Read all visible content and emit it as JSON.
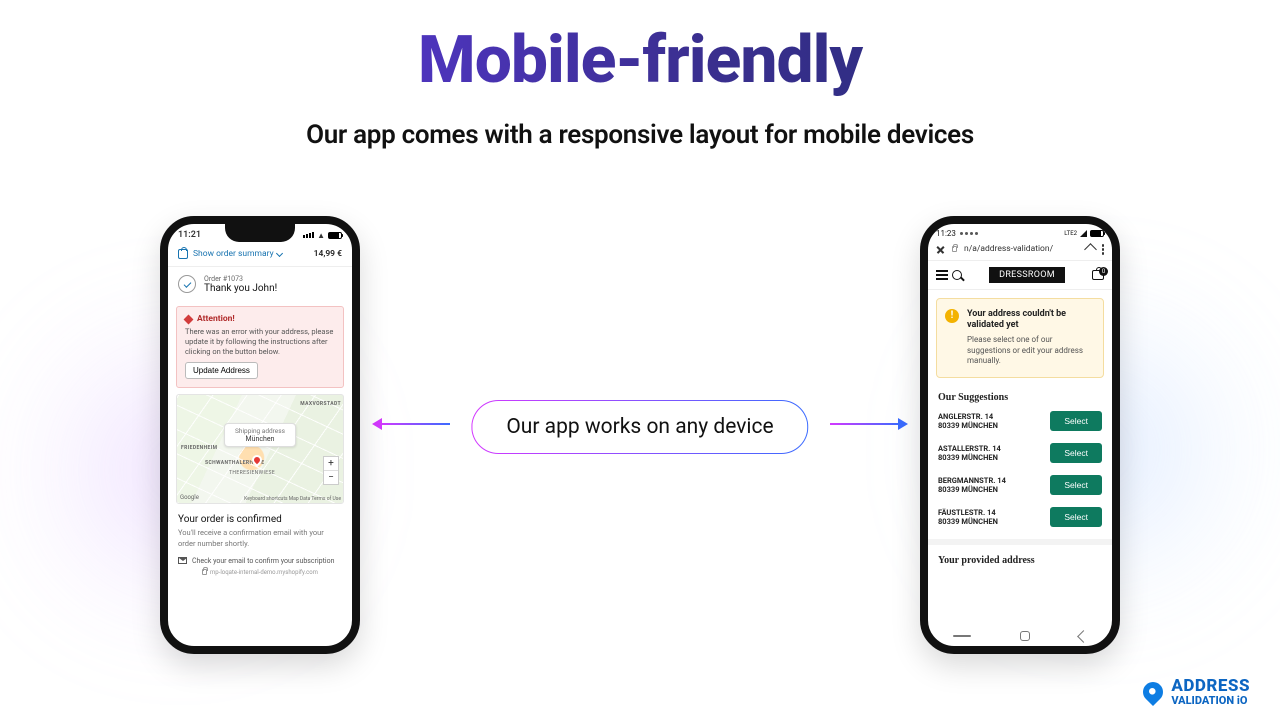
{
  "hero": {
    "title": "Mobile-friendly",
    "subtitle": "Our app comes with a responsive layout for mobile devices",
    "pill": "Our app works on any device"
  },
  "footer_logo": {
    "line1": "ADDRESS",
    "line2": "VALIDATION iO"
  },
  "left_phone": {
    "status_time": "11:21",
    "summary_label": "Show order summary",
    "summary_price": "14,99 €",
    "order_label": "Order #1073",
    "thank_you": "Thank you John!",
    "alert_title": "Attention!",
    "alert_body": "There was an error with your address, please update it by following the instructions after clicking on the button below.",
    "alert_button": "Update Address",
    "map_chip_title": "Shipping address",
    "map_chip_city": "München",
    "map_attrib": "Keyboard shortcuts   Map Data   Terms of Use",
    "map_google": "Google",
    "map_labels": {
      "nw": "FRIEDENHEIM",
      "ne": "MAXVORSTADT",
      "mid": "SCHWANTHALERHÖHE",
      "sub": "THERESIENWIESE"
    },
    "confirmed_h": "Your order is confirmed",
    "confirmed_p": "You'll receive a confirmation email with your order number shortly.",
    "sub_text": "Check your email to confirm your subscription",
    "site_url": "mp-loqate-internal-demo.myshopify.com"
  },
  "right_phone": {
    "status_time": "11:23",
    "status_net": "LTE2",
    "url": "n/a/address-validation/",
    "brand": "DRESSROOM",
    "cart_count": "0",
    "warn_title": "Your address couldn't be validated yet",
    "warn_body": "Please select one of our suggestions or edit your address manually.",
    "suggestions_h": "Our Suggestions",
    "select_label": "Select",
    "suggestions": [
      {
        "line1": "ANGLERSTR. 14",
        "line2": "80339 MÜNCHEN"
      },
      {
        "line1": "ASTALLERSTR. 14",
        "line2": "80339 MÜNCHEN"
      },
      {
        "line1": "BERGMANNSTR. 14",
        "line2": "80339 MÜNCHEN"
      },
      {
        "line1": "FÄUSTLESTR. 14",
        "line2": "80339 MÜNCHEN"
      }
    ],
    "provided_h": "Your provided address"
  }
}
